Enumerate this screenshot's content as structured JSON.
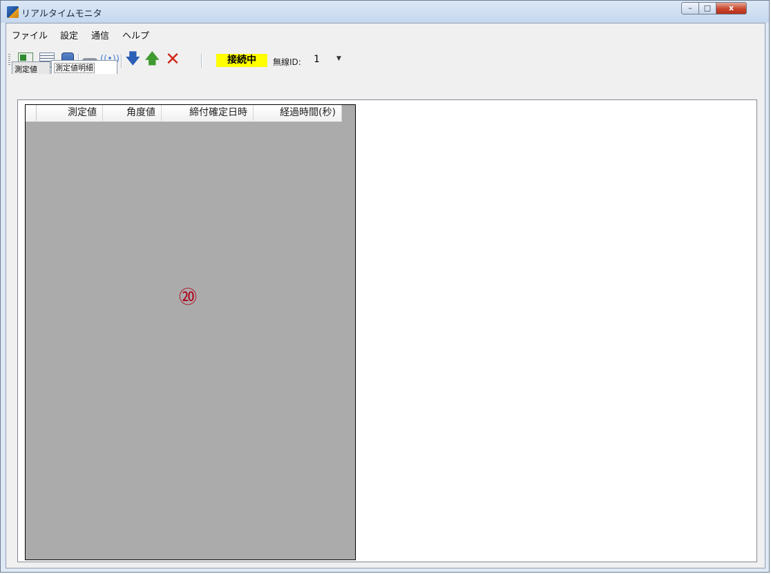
{
  "window": {
    "title": "リアルタイムモニタ",
    "controls": {
      "minimize": "–",
      "maximize": "□",
      "close": "x"
    }
  },
  "menu": [
    "ファイル",
    "設定",
    "通信",
    "ヘルプ"
  ],
  "toolbar": {
    "icons": [
      "excel-export-icon",
      "list-icon",
      "device-icon",
      "cable-icon",
      "wireless-signal-icon",
      "arrow-down-icon",
      "arrow-up-icon",
      "delete-x-icon"
    ],
    "arrow_down": "🡇",
    "arrow_up": "🡅",
    "delete": "✕",
    "signal": "((•))",
    "status": "接続中",
    "status_color": "#ffff00",
    "radio_id_label": "無線ID:",
    "radio_id_value": "1",
    "dropdown_arrow": "▼"
  },
  "tabs": [
    {
      "label": "測定値",
      "active": false
    },
    {
      "label": "測定値明細",
      "active": true
    }
  ],
  "grid": {
    "columns": [
      "測定値",
      "角度値",
      "締付確定日時",
      "経過時間(秒)"
    ],
    "rows": [],
    "background": "#ababab"
  },
  "annotation": {
    "marker": "⑳"
  }
}
